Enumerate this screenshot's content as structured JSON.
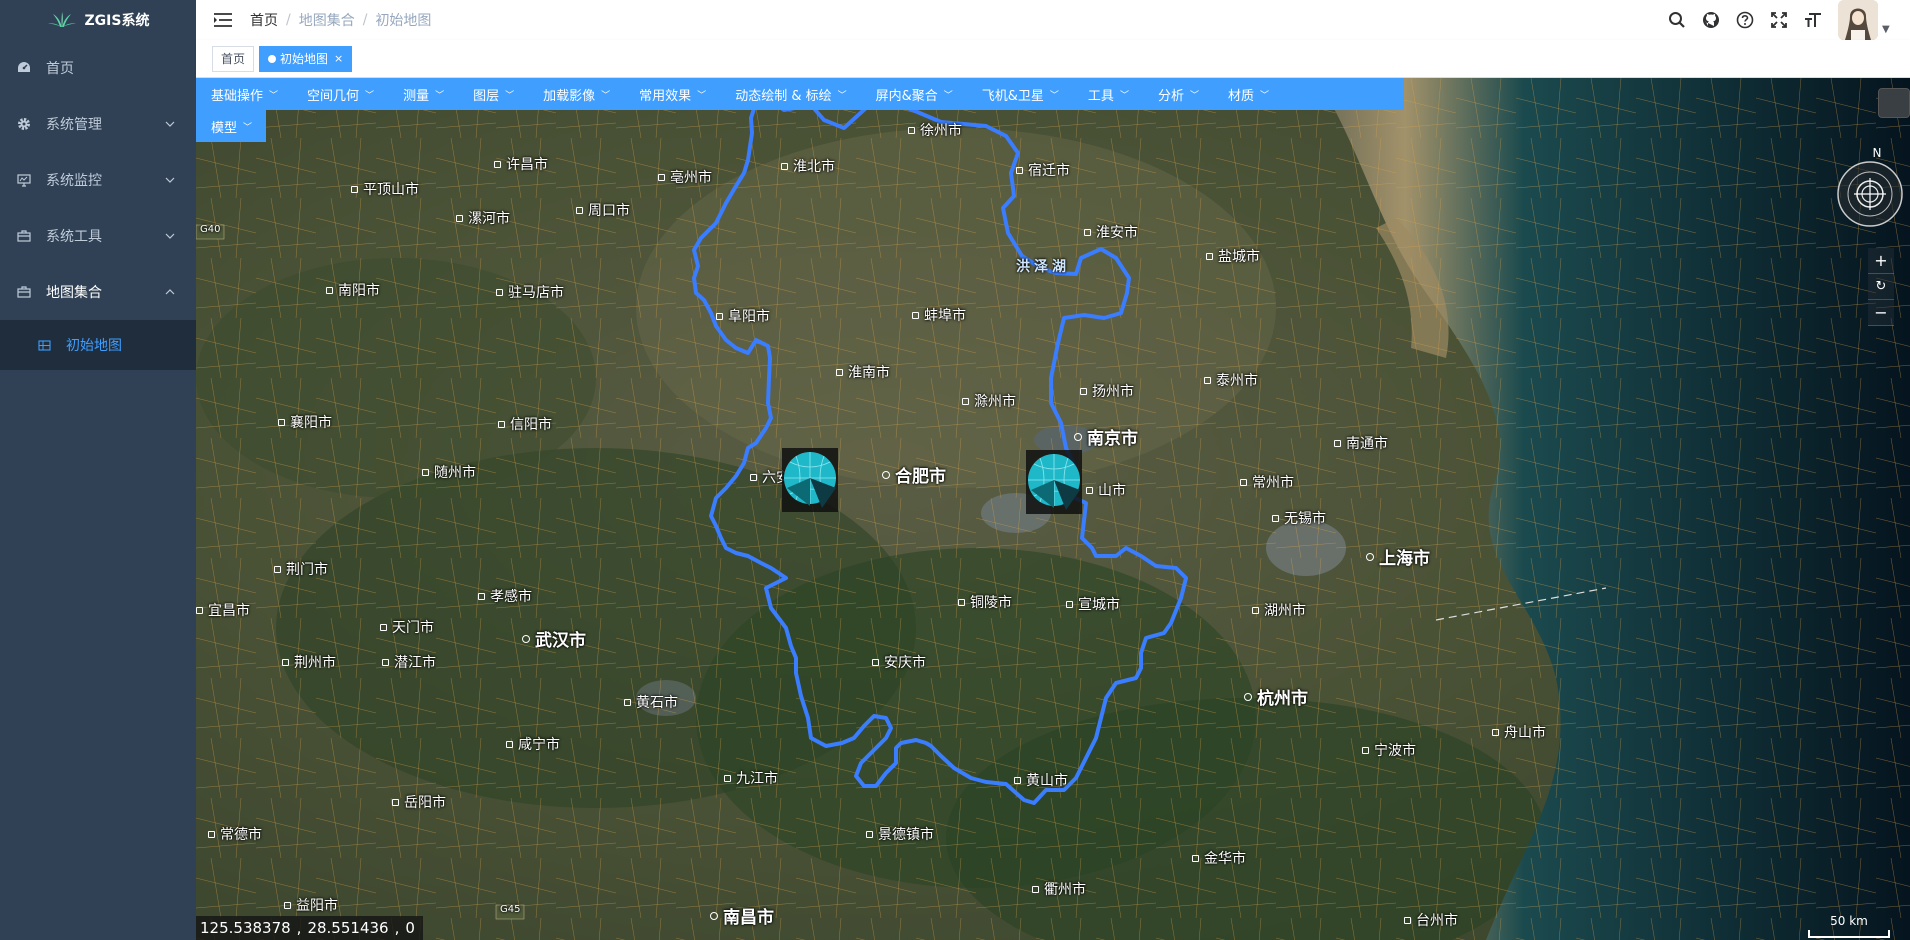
{
  "sidebar": {
    "logo_text": "ZGIS系统",
    "items": [
      {
        "label": "首页",
        "icon": "dashboard-icon"
      },
      {
        "label": "系统管理",
        "icon": "gear-icon"
      },
      {
        "label": "系统监控",
        "icon": "monitor-icon"
      },
      {
        "label": "系统工具",
        "icon": "toolbox-icon"
      },
      {
        "label": "地图集合",
        "icon": "briefcase-icon"
      }
    ],
    "sub_items": [
      {
        "label": "初始地图",
        "icon": "grid-icon"
      }
    ]
  },
  "header": {
    "breadcrumb": [
      "首页",
      "地图集合",
      "初始地图"
    ]
  },
  "tags": {
    "home": "首页",
    "active": "初始地图"
  },
  "toolbar": {
    "items": [
      "基础操作",
      "空间几何",
      "测量",
      "图层",
      "加载影像",
      "常用效果",
      "动态绘制 & 标绘",
      "屏内&聚合",
      "飞机&卫星",
      "工具",
      "分析",
      "材质"
    ],
    "row2": [
      "模型"
    ]
  },
  "map": {
    "cities": [
      {
        "name": "徐州市",
        "big": false
      },
      {
        "name": "许昌市",
        "big": false
      },
      {
        "name": "淮北市",
        "big": false
      },
      {
        "name": "宿迁市",
        "big": false
      },
      {
        "name": "亳州市",
        "big": false
      },
      {
        "name": "平顶山市",
        "big": false
      },
      {
        "name": "漯河市",
        "big": false
      },
      {
        "name": "周口市",
        "big": false
      },
      {
        "name": "淮安市",
        "big": false
      },
      {
        "name": "盐城市",
        "big": false
      },
      {
        "name": "洪泽湖",
        "big": false
      },
      {
        "name": "南阳市",
        "big": false
      },
      {
        "name": "驻马店市",
        "big": false
      },
      {
        "name": "阜阳市",
        "big": false
      },
      {
        "name": "蚌埠市",
        "big": false
      },
      {
        "name": "淮南市",
        "big": false
      },
      {
        "name": "扬州市",
        "big": false
      },
      {
        "name": "泰州市",
        "big": false
      },
      {
        "name": "滁州市",
        "big": false
      },
      {
        "name": "襄阳市",
        "big": false
      },
      {
        "name": "信阳市",
        "big": false
      },
      {
        "name": "南京市",
        "big": true
      },
      {
        "name": "南通市",
        "big": false
      },
      {
        "name": "随州市",
        "big": false
      },
      {
        "name": "六安市",
        "big": false
      },
      {
        "name": "合肥市",
        "big": true
      },
      {
        "name": "山市",
        "big": false
      },
      {
        "name": "常州市",
        "big": false
      },
      {
        "name": "无锡市",
        "big": false
      },
      {
        "name": "上海市",
        "big": true
      },
      {
        "name": "荆门市",
        "big": false
      },
      {
        "name": "孝感市",
        "big": false
      },
      {
        "name": "铜陵市",
        "big": false
      },
      {
        "name": "宣城市",
        "big": false
      },
      {
        "name": "湖州市",
        "big": false
      },
      {
        "name": "宜昌市",
        "big": false
      },
      {
        "name": "天门市",
        "big": false
      },
      {
        "name": "武汉市",
        "big": true
      },
      {
        "name": "荆州市",
        "big": false
      },
      {
        "name": "潜江市",
        "big": false
      },
      {
        "name": "安庆市",
        "big": false
      },
      {
        "name": "杭州市",
        "big": true
      },
      {
        "name": "黄石市",
        "big": false
      },
      {
        "name": "咸宁市",
        "big": false
      },
      {
        "name": "九江市",
        "big": false
      },
      {
        "name": "黄山市",
        "big": false
      },
      {
        "name": "宁波市",
        "big": false
      },
      {
        "name": "舟山市",
        "big": false
      },
      {
        "name": "岳阳市",
        "big": false
      },
      {
        "name": "常德市",
        "big": false
      },
      {
        "name": "景德镇市",
        "big": false
      },
      {
        "name": "金华市",
        "big": false
      },
      {
        "name": "衢州市",
        "big": false
      },
      {
        "name": "益阳市",
        "big": false
      },
      {
        "name": "南昌市",
        "big": true
      },
      {
        "name": "台州市",
        "big": false
      }
    ],
    "highway_labels": [
      "G40",
      "G45"
    ],
    "compass_label": "N",
    "coords": {
      "lon": "125.538378",
      "lat": "28.551436",
      "height": "0"
    },
    "scale_label": "50 km"
  },
  "colors": {
    "sidebar_bg": "#304156",
    "accent": "#409eff",
    "boundary": "#3a7dff"
  }
}
